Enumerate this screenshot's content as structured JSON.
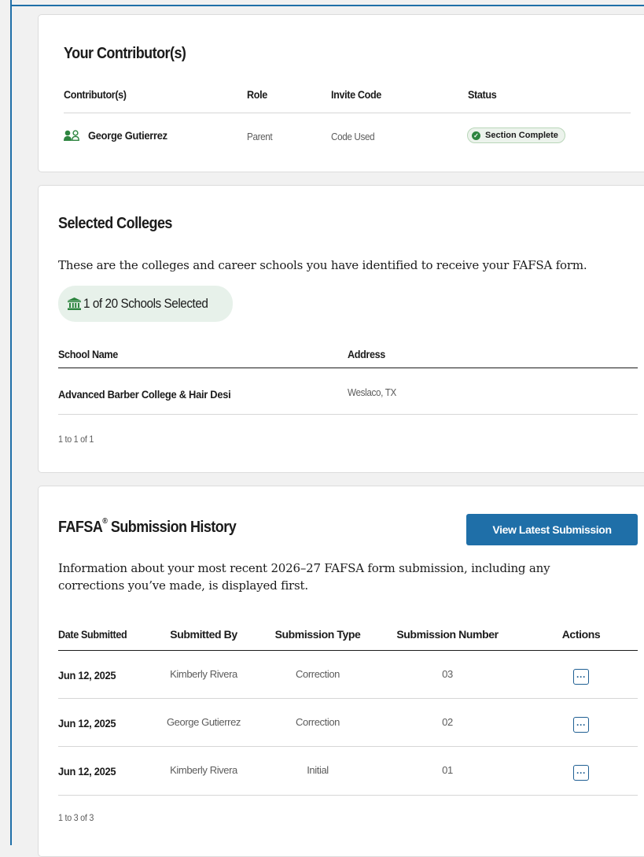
{
  "contributors": {
    "title": "Your Contributor(s)",
    "columns": [
      "Contributor(s)",
      "Role",
      "Invite Code",
      "Status"
    ],
    "rows": [
      {
        "name": "George Gutierrez",
        "role": "Parent",
        "invite_code": "Code Used",
        "status": "Section Complete",
        "icon": "people-icon"
      }
    ],
    "status_color": "#2e8540",
    "icon_color": "#2e8540"
  },
  "colleges": {
    "title": "Selected Colleges",
    "description": "These are the colleges and career schools you have identified to receive your FAFSA form.",
    "count_label": "1 of 20 Schools Selected",
    "count_icon": "institution-icon",
    "columns": [
      "School Name",
      "Address"
    ],
    "rows": [
      {
        "name": "Advanced Barber College & Hair Desi",
        "address": "Weslaco, TX"
      }
    ],
    "pager": "1 to 1 of 1"
  },
  "history": {
    "title": "FAFSA",
    "title_sup": "®",
    "title_rest": " Submission History",
    "view_button": "View Latest Submission",
    "description": "Information about your most recent 2026–27 FAFSA form submission, including any corrections you’ve made, is displayed first.",
    "columns": [
      "Date Submitted",
      "Submitted By",
      "Submission Type",
      "Submission Number",
      "Actions"
    ],
    "rows": [
      {
        "date": "Jun 12, 2025",
        "by": "Kimberly Rivera",
        "type": "Correction",
        "number": "03",
        "action_icon": "more-options-icon"
      },
      {
        "date": "Jun 12, 2025",
        "by": "George Gutierrez",
        "type": "Correction",
        "number": "02",
        "action_icon": "more-options-icon"
      },
      {
        "date": "Jun 12, 2025",
        "by": "Kimberly Rivera",
        "type": "Initial",
        "number": "01",
        "action_icon": "more-options-icon"
      }
    ],
    "pager": "1 to 3 of 3"
  },
  "colors": {
    "primary": "#1f6fa8",
    "success": "#2e8540",
    "pill_bg": "#e7f1ea"
  }
}
